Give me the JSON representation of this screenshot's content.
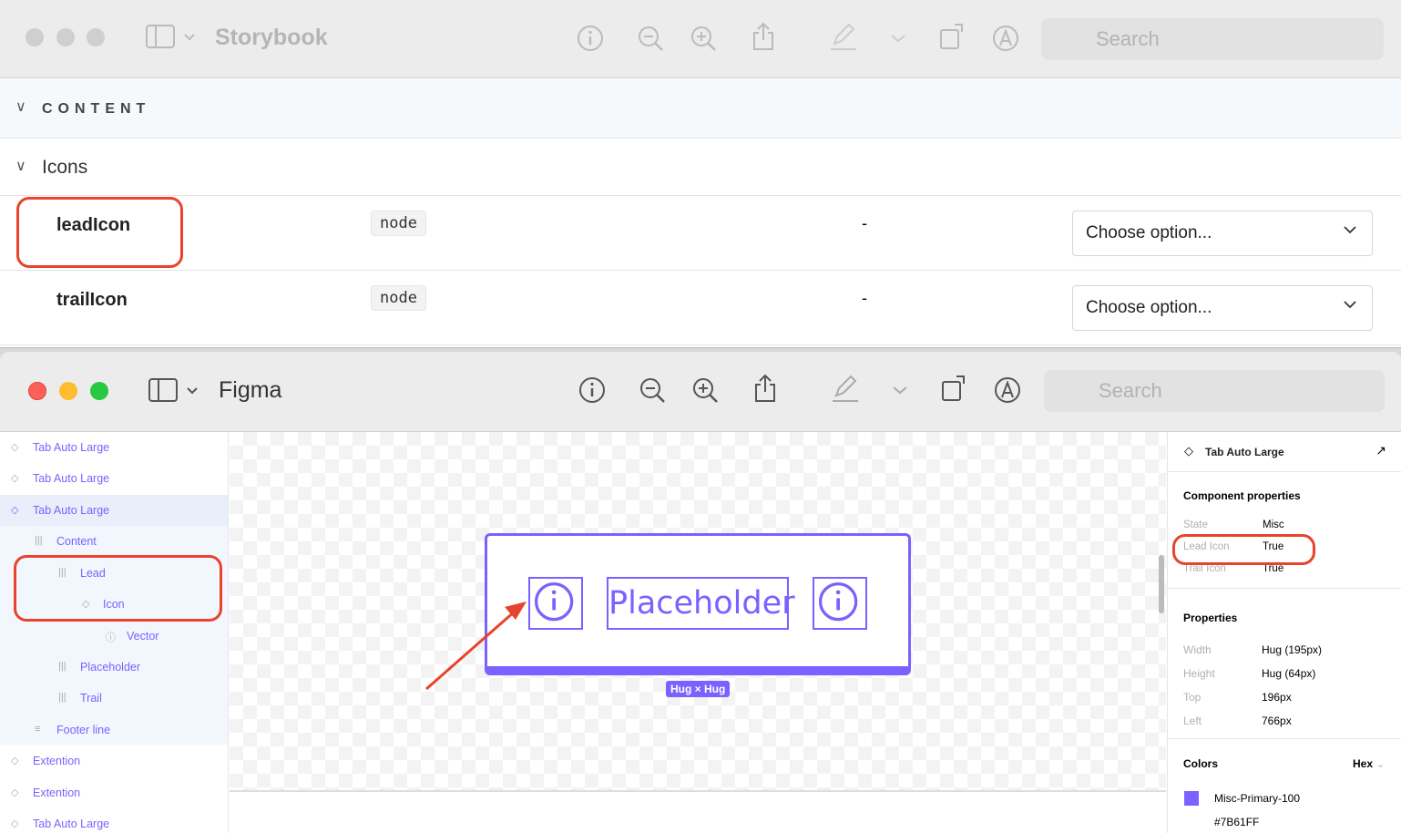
{
  "storybook": {
    "title": "Storybook",
    "search_placeholder": "Search",
    "section": "CONTENT",
    "group": "Icons",
    "rows": [
      {
        "name": "leadIcon",
        "type": "node",
        "default": "-",
        "control": "Choose option..."
      },
      {
        "name": "trailIcon",
        "type": "node",
        "default": "-",
        "control": "Choose option..."
      }
    ]
  },
  "figma": {
    "title": "Figma",
    "search_placeholder": "Search",
    "layers": [
      "Tab Auto Large",
      "Tab Auto Large",
      "Tab Auto Large",
      "Content",
      "Lead",
      "Icon",
      "Vector",
      "Placeholder",
      "Trail",
      "Footer line",
      "Extention",
      "Extention",
      "Tab Auto Large"
    ],
    "canvas": {
      "placeholder_text": "Placeholder",
      "size_badge": "Hug × Hug"
    },
    "panel": {
      "selected": "Tab Auto Large",
      "component_properties_title": "Component properties",
      "component_properties": [
        {
          "label": "State",
          "value": "Misc"
        },
        {
          "label": "Lead Icon",
          "value": "True"
        },
        {
          "label": "Trail Icon",
          "value": "True"
        }
      ],
      "properties_title": "Properties",
      "properties": [
        {
          "label": "Width",
          "value": "Hug (195px)"
        },
        {
          "label": "Height",
          "value": "Hug (64px)"
        },
        {
          "label": "Top",
          "value": "196px"
        },
        {
          "label": "Left",
          "value": "766px"
        }
      ],
      "colors_title": "Colors",
      "color_format": "Hex",
      "color_name": "Misc-Primary-100",
      "color_hex": "#7B61FF"
    }
  },
  "colors": {
    "accent": "#7B61FF",
    "annotation": "#E8432C"
  }
}
